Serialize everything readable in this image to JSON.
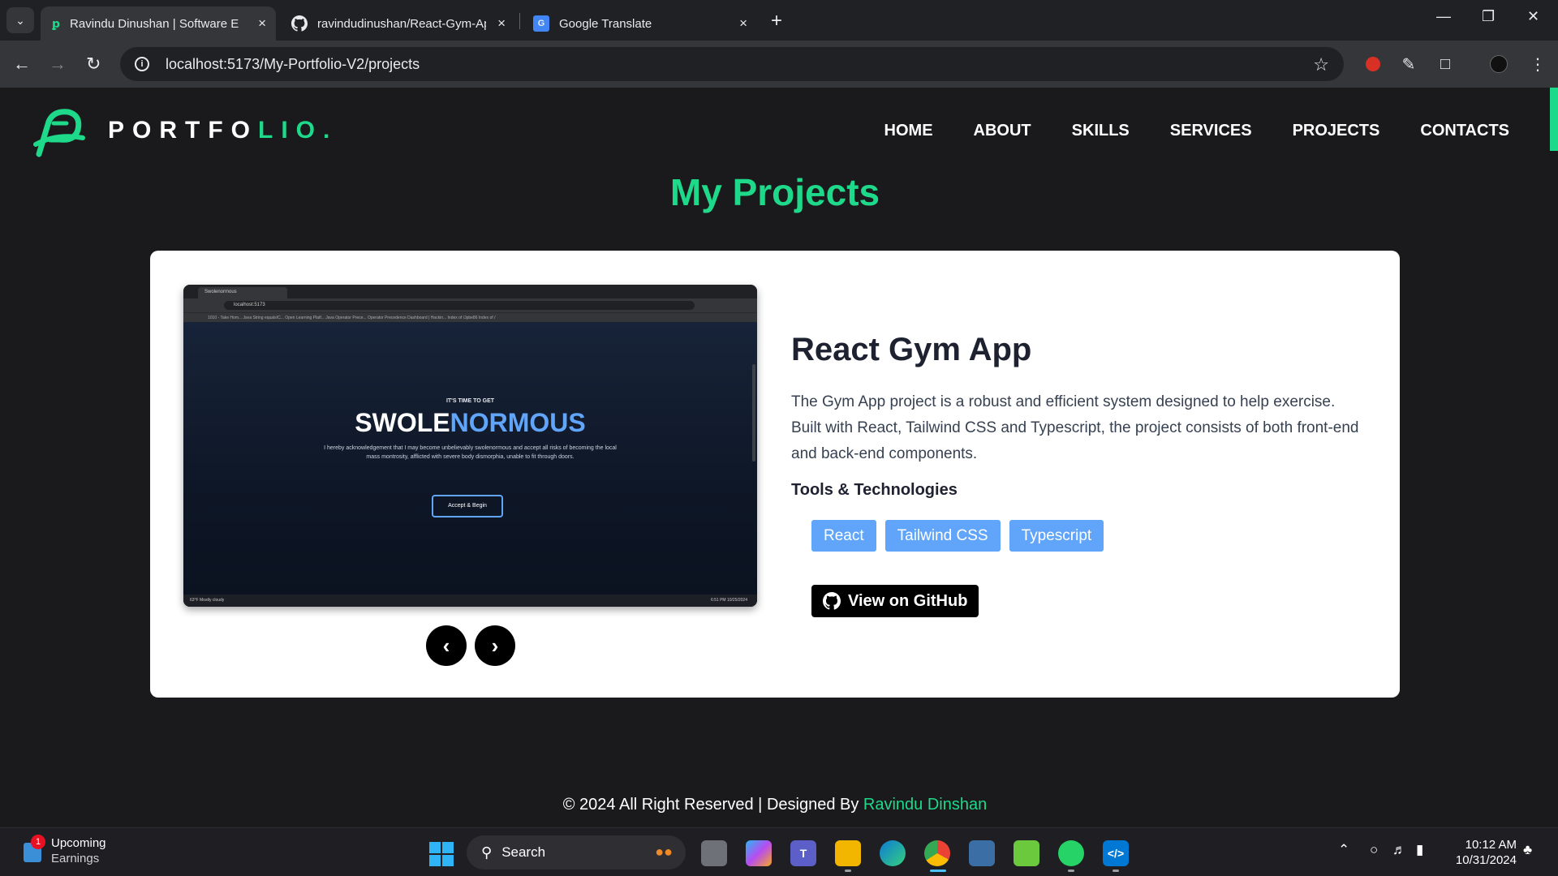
{
  "browser": {
    "tabs": [
      {
        "title": "Ravindu Dinushan | Software En",
        "favicon": "portfolio-icon",
        "active": true
      },
      {
        "title": "ravindudinushan/React-Gym-Ap",
        "favicon": "github-icon",
        "active": false
      },
      {
        "title": "Google Translate",
        "favicon": "google-translate-icon",
        "active": false
      }
    ],
    "close_glyph": "×",
    "new_tab_glyph": "+",
    "url": "localhost:5173/My-Portfolio-V2/projects"
  },
  "site": {
    "brand_white": "PORTFO",
    "brand_green": "LIO.",
    "nav": [
      "HOME",
      "ABOUT",
      "SKILLS",
      "SERVICES",
      "PROJECTS",
      "CONTACTS"
    ],
    "section_title": "My Projects",
    "accent_color": "#1ed98a"
  },
  "project": {
    "title": "React Gym App",
    "description": "The Gym App project is a robust and efficient system designed to help exercise. Built with React, Tailwind CSS and Typescript, the project consists of both front-end and back-end components.",
    "tools_title": "Tools & Technologies",
    "tags": [
      "React",
      "Tailwind CSS",
      "Typescript"
    ],
    "github_label": "View on GitHub",
    "screenshot": {
      "tab_title": "Swolenormous",
      "url": "localhost:5173",
      "bookmarks": "1010 - Take Hom...   Java String equalsIC...   Open Learning Platf...   Java Operator Prece...   Operator Precedence   Dashboard | Hackin...   Index of /Jpbe86   Index of /",
      "kicker": "IT'S TIME TO GET",
      "title_white": "SWOLE",
      "title_blue": "NORMOUS",
      "body": "I hereby acknowledgement that I may become unbelievably swolenormous and accept all risks of becoming the local mass montrosity, afflicted with severe body dismorphia, unable to fit through doors.",
      "button": "Accept & Begin",
      "taskbar_left": "63°F Mostly cloudy",
      "taskbar_time": "6:51 PM 10/25/2024"
    }
  },
  "footer": {
    "text": "© 2024 All Right Reserved | Designed By ",
    "author": "Ravindu Dinshan"
  },
  "taskbar": {
    "weather_badge": "1",
    "weather_title": "Upcoming",
    "weather_sub": "Earnings",
    "search": "Search",
    "time": "10:12 AM",
    "date": "10/31/2024"
  }
}
